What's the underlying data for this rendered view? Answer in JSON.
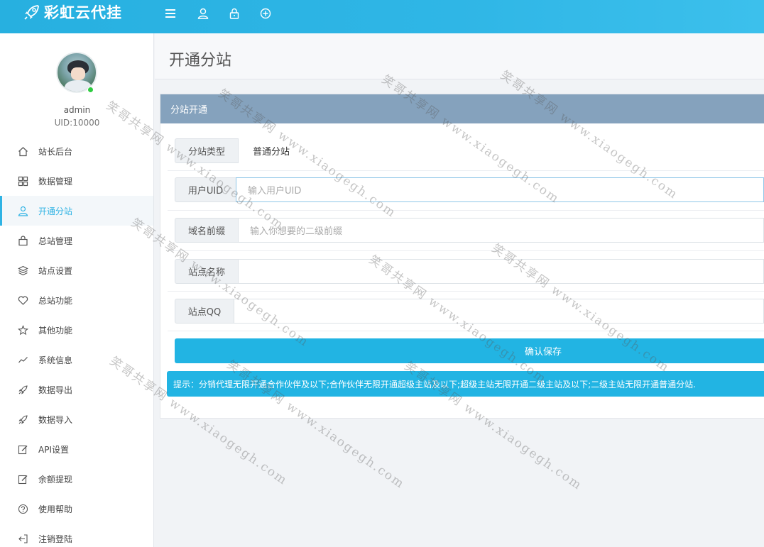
{
  "header": {
    "brand": "彩虹云代挂",
    "icons": [
      "menu-icon",
      "user-icon",
      "lock-icon",
      "plus-circle-icon"
    ]
  },
  "sidebar": {
    "username": "admin",
    "uid": "UID:10000",
    "items": [
      {
        "label": "站长后台",
        "icon": "home-icon"
      },
      {
        "label": "数据管理",
        "icon": "grid-icon"
      },
      {
        "label": "开通分站",
        "icon": "user-icon",
        "active": true
      },
      {
        "label": "总站管理",
        "icon": "bag-icon"
      },
      {
        "label": "站点设置",
        "icon": "layers-icon"
      },
      {
        "label": "总站功能",
        "icon": "heart-icon"
      },
      {
        "label": "其他功能",
        "icon": "star-icon"
      },
      {
        "label": "系统信息",
        "icon": "trend-icon"
      },
      {
        "label": "数据导出",
        "icon": "rocket-icon"
      },
      {
        "label": "数据导入",
        "icon": "rocket-icon"
      },
      {
        "label": "API设置",
        "icon": "edit-icon"
      },
      {
        "label": "余额提现",
        "icon": "edit-icon"
      },
      {
        "label": "使用帮助",
        "icon": "help-icon"
      },
      {
        "label": "注销登陆",
        "icon": "logout-icon"
      }
    ]
  },
  "main": {
    "page_title": "开通分站",
    "panel_title": "分站开通",
    "form": {
      "site_type": {
        "label": "分站类型",
        "value": "普通分站"
      },
      "user_uid": {
        "label": "用户UID",
        "placeholder": "输入用户UID"
      },
      "domain_prefix": {
        "label": "域名前缀",
        "placeholder": "输入你想要的二级前缀"
      },
      "site_name": {
        "label": "站点名称",
        "placeholder": ""
      },
      "site_qq": {
        "label": "站点QQ",
        "placeholder": ""
      },
      "save_label": "确认保存"
    },
    "tip": "提示：分销代理无限开通合作伙伴及以下;合作伙伴无限开通超级主站及以下;超级主站无限开通二级主站及以下;二级主站无限开通普通分站."
  },
  "watermark": "笑哥共享网 www.xiaogegh.com",
  "colors": {
    "accent": "#22b4e3",
    "panel_header": "#85a2bd",
    "active_nav": "#2fb3e4"
  }
}
